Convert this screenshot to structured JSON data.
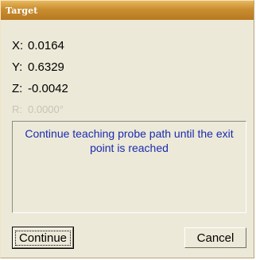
{
  "window": {
    "title": "Target"
  },
  "coordinates": [
    {
      "label": "X:",
      "value": "0.0164",
      "enabled": true
    },
    {
      "label": "Y:",
      "value": "0.6329",
      "enabled": true
    },
    {
      "label": "Z:",
      "value": "-0.0042",
      "enabled": true
    },
    {
      "label": "R:",
      "value": "0.0000°",
      "enabled": false
    }
  ],
  "message": {
    "text": "Continue teaching probe path until the exit point is reached"
  },
  "buttons": {
    "continue_label": "Continue",
    "cancel_label": "Cancel"
  },
  "colors": {
    "titlebar": "#c98d31",
    "message_text": "#1a2bb0",
    "dialog_bg": "#ece9d8",
    "disabled_text": "#c8c4b8"
  }
}
